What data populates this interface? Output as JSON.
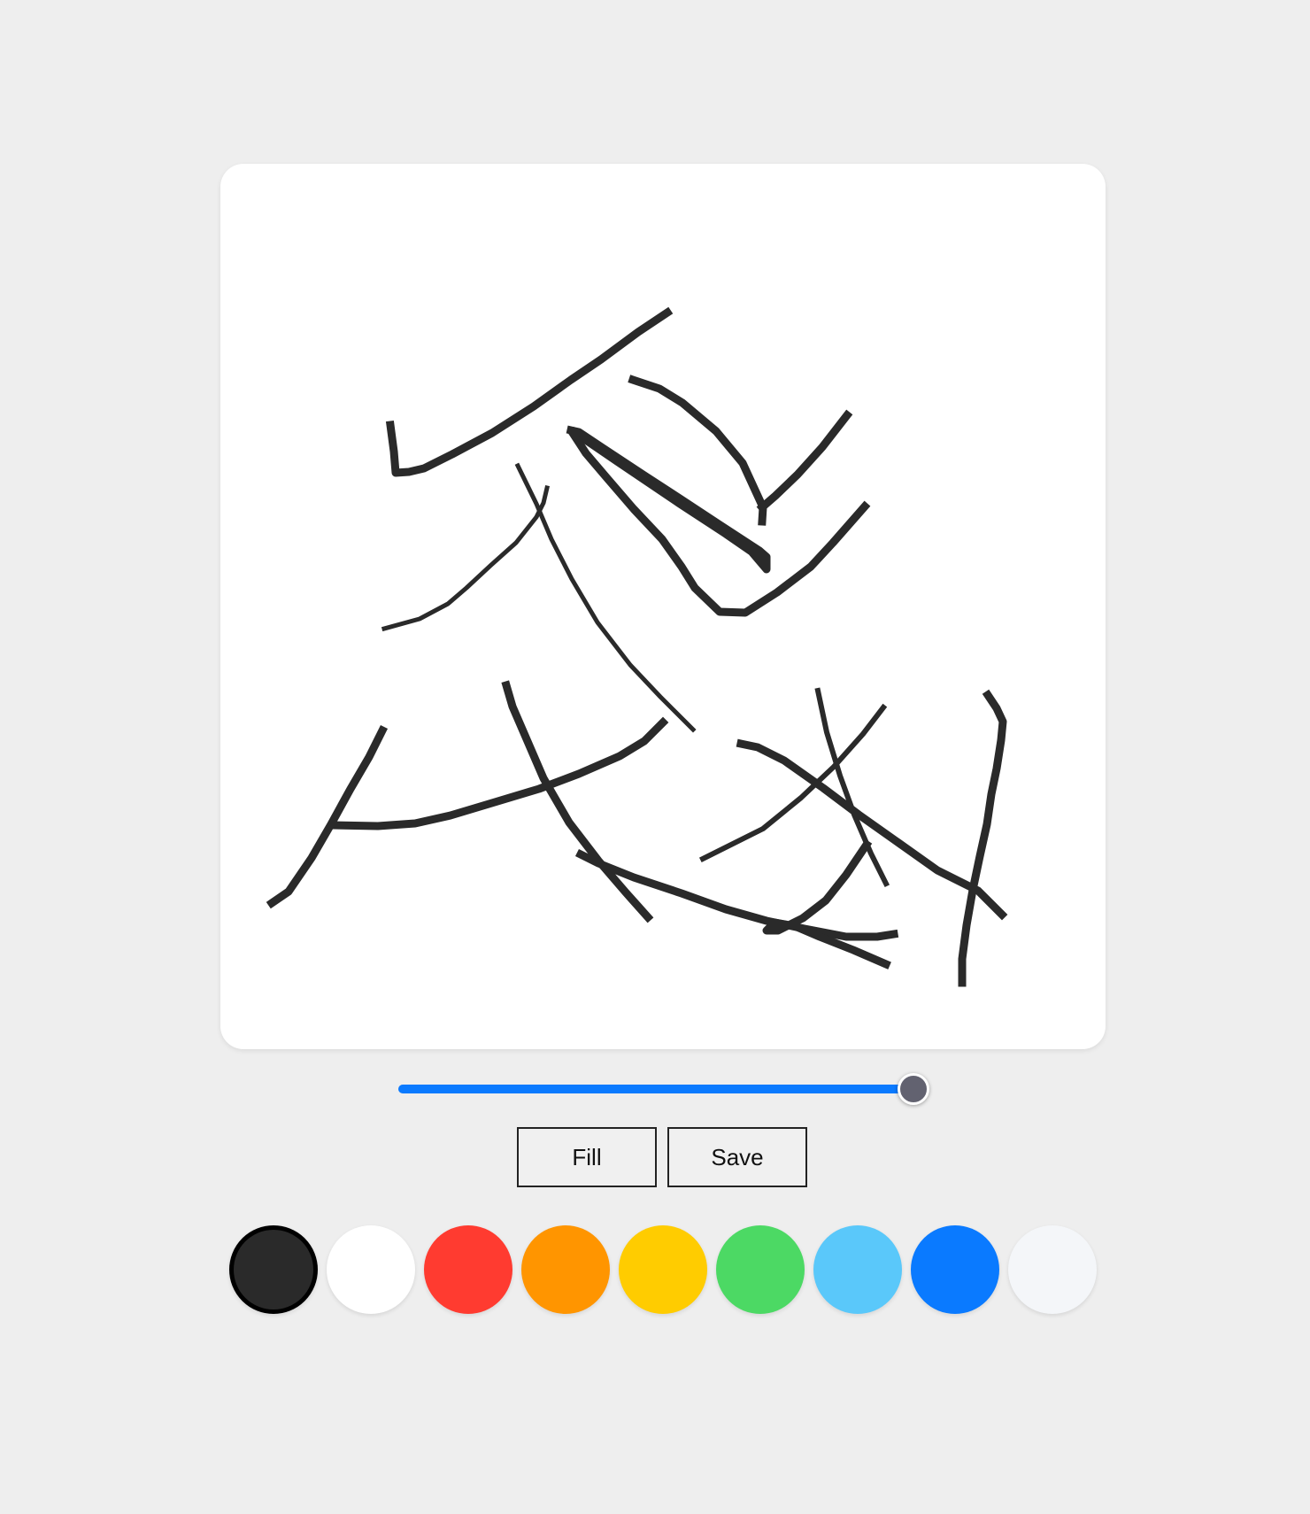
{
  "canvas": {
    "background": "#ffffff",
    "stroke_color": "#2a2a2a"
  },
  "brush_size_slider": {
    "value_fraction": 0.97,
    "track_color": "#d0d0d5",
    "fill_color": "#0a7aff",
    "thumb_color": "#626270"
  },
  "buttons": {
    "fill_label": "Fill",
    "save_label": "Save"
  },
  "palette": {
    "selected_index": 0,
    "colors": [
      "#2a2a2a",
      "#ffffff",
      "#ff3b30",
      "#ff9500",
      "#ffcc00",
      "#4cd964",
      "#5ac8fa",
      "#0a7aff",
      "#f4f6f9"
    ]
  }
}
